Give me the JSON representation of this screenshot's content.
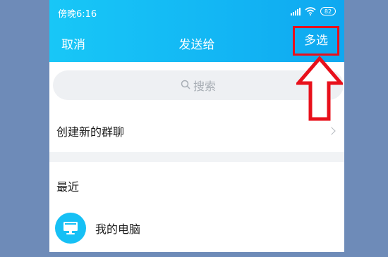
{
  "status_bar": {
    "time": "傍晚6:16",
    "battery": "82"
  },
  "nav": {
    "cancel": "取消",
    "title": "发送给",
    "multi_select": "多选"
  },
  "search": {
    "placeholder": "搜索"
  },
  "create_group": {
    "label": "创建新的群聊"
  },
  "recent": {
    "header": "最近",
    "items": [
      {
        "name": "我的电脑",
        "icon": "computer-icon"
      }
    ]
  },
  "colors": {
    "header_blue": "#13b7f4",
    "highlight_red": "#e8101b",
    "avatar_blue": "#16c0f5"
  }
}
